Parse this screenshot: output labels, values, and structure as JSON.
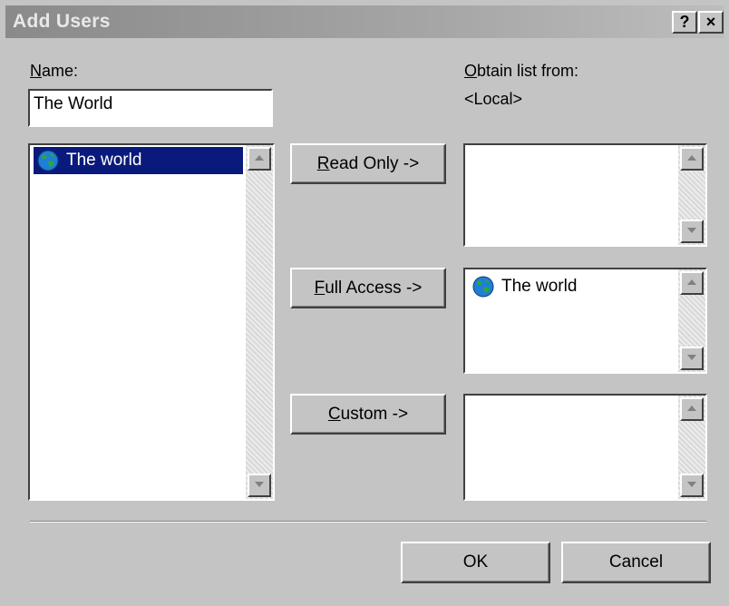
{
  "window": {
    "title": "Add Users",
    "help_label": "?",
    "close_label": "×"
  },
  "name_label_ul": "N",
  "name_label_rest": "ame:",
  "name_value": "The World",
  "obtain_label_ul": "O",
  "obtain_label_rest": "btain list from:",
  "obtain_value": "<Local>",
  "source_list": {
    "items": [
      {
        "label": "The world",
        "icon": "globe-icon",
        "selected": true
      }
    ]
  },
  "buttons": {
    "read_only_ul": "R",
    "read_only_rest": "ead Only ->",
    "full_access_ul": "F",
    "full_access_rest": "ull Access ->",
    "custom_ul": "C",
    "custom_rest": "ustom ->",
    "ok": "OK",
    "cancel": "Cancel"
  },
  "read_only_list": {
    "items": []
  },
  "full_access_list": {
    "items": [
      {
        "label": "The world",
        "icon": "globe-icon"
      }
    ]
  },
  "custom_list": {
    "items": []
  },
  "colors": {
    "selection": "#0a1a7c",
    "face": "#c4c4c4"
  }
}
